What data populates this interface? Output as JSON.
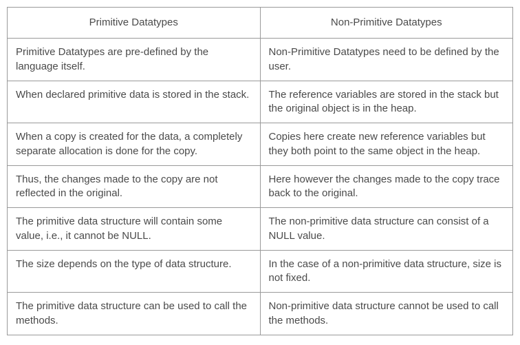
{
  "table": {
    "headers": {
      "col1": "Primitive Datatypes",
      "col2": "Non-Primitive Datatypes"
    },
    "rows": [
      {
        "col1": "Primitive Datatypes are pre-defined by the language itself.",
        "col2": "Non-Primitive Datatypes need to be defined by the user."
      },
      {
        "col1": "When declared primitive data is stored in the stack.",
        "col2": "The reference variables are stored in the stack but the original object is in the heap."
      },
      {
        "col1": "When a copy is created for the data, a completely separate allocation is done for the copy.",
        "col2": "Copies here create new reference variables but they both point to the same object in the heap."
      },
      {
        "col1": "Thus, the changes made to the copy are not reflected in the original.",
        "col2": "Here however the changes made to the copy trace back to the original."
      },
      {
        "col1": "The primitive data structure will contain some value, i.e., it cannot be NULL.",
        "col2": "The non-primitive data structure can consist of a NULL value."
      },
      {
        "col1": "The size depends on the type of data structure.",
        "col2": "In the case of a non-primitive data structure, size is not fixed."
      },
      {
        "col1": "The primitive data structure can be used to call the methods.",
        "col2": "Non-primitive data structure cannot be used to call the methods."
      }
    ]
  }
}
